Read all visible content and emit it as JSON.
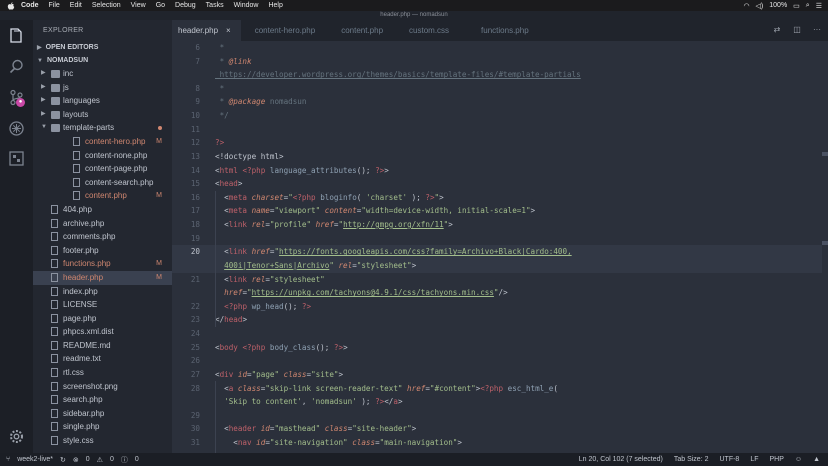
{
  "menubar": {
    "app": "Code",
    "items": [
      "File",
      "Edit",
      "Selection",
      "View",
      "Go",
      "Debug",
      "Tasks",
      "Window",
      "Help"
    ],
    "battery": "100%",
    "window_title": "header.php — nomadsun"
  },
  "sidebar": {
    "title": "EXPLORER",
    "open_editors": "OPEN EDITORS",
    "project": "NOMADSUN",
    "tree": [
      {
        "label": "inc",
        "type": "folder",
        "depth": 1
      },
      {
        "label": "js",
        "type": "folder",
        "depth": 1
      },
      {
        "label": "languages",
        "type": "folder",
        "depth": 1
      },
      {
        "label": "layouts",
        "type": "folder",
        "depth": 1
      },
      {
        "label": "template-parts",
        "type": "folder-open",
        "depth": 1,
        "mark": "dot"
      },
      {
        "label": "content-hero.php",
        "type": "file",
        "depth": 2,
        "mark": "M"
      },
      {
        "label": "content-none.php",
        "type": "file",
        "depth": 2,
        "mark": ""
      },
      {
        "label": "content-page.php",
        "type": "file",
        "depth": 2,
        "mark": ""
      },
      {
        "label": "content-search.php",
        "type": "file",
        "depth": 2,
        "mark": ""
      },
      {
        "label": "content.php",
        "type": "file",
        "depth": 2,
        "mark": "M"
      },
      {
        "label": "404.php",
        "type": "file",
        "depth": 1,
        "mark": ""
      },
      {
        "label": "archive.php",
        "type": "file",
        "depth": 1,
        "mark": ""
      },
      {
        "label": "comments.php",
        "type": "file",
        "depth": 1,
        "mark": ""
      },
      {
        "label": "footer.php",
        "type": "file",
        "depth": 1,
        "mark": ""
      },
      {
        "label": "functions.php",
        "type": "file",
        "depth": 1,
        "mark": "M"
      },
      {
        "label": "header.php",
        "type": "file",
        "depth": 1,
        "mark": "M",
        "active": true
      },
      {
        "label": "index.php",
        "type": "file",
        "depth": 1,
        "mark": ""
      },
      {
        "label": "LICENSE",
        "type": "file",
        "depth": 1,
        "mark": ""
      },
      {
        "label": "page.php",
        "type": "file",
        "depth": 1,
        "mark": ""
      },
      {
        "label": "phpcs.xml.dist",
        "type": "file",
        "depth": 1,
        "mark": ""
      },
      {
        "label": "README.md",
        "type": "file",
        "depth": 1,
        "mark": ""
      },
      {
        "label": "readme.txt",
        "type": "file",
        "depth": 1,
        "mark": ""
      },
      {
        "label": "rtl.css",
        "type": "file",
        "depth": 1,
        "mark": ""
      },
      {
        "label": "screenshot.png",
        "type": "file",
        "depth": 1,
        "mark": ""
      },
      {
        "label": "search.php",
        "type": "file",
        "depth": 1,
        "mark": ""
      },
      {
        "label": "sidebar.php",
        "type": "file",
        "depth": 1,
        "mark": ""
      },
      {
        "label": "single.php",
        "type": "file",
        "depth": 1,
        "mark": ""
      },
      {
        "label": "style.css",
        "type": "file",
        "depth": 1,
        "mark": ""
      }
    ]
  },
  "tabs": [
    {
      "label": "header.php",
      "active": true,
      "close": "×"
    },
    {
      "label": "content-hero.php",
      "active": false
    },
    {
      "label": "content.php",
      "active": false
    },
    {
      "label": "custom.css",
      "active": false
    },
    {
      "label": "functions.php",
      "active": false
    }
  ],
  "editor": {
    "current_line": "20",
    "lines": [
      {
        "n": "6",
        "html": "<span class='c-comment'> *</span>"
      },
      {
        "n": "7",
        "html": "<span class='c-comment'> * <span class='c-attr'>@link</span></span>"
      },
      {
        "n": "",
        "html": "<span class='c-url'> https://developer.wordpress.org/themes/basics/template-files/#template-partials</span>"
      },
      {
        "n": "8",
        "html": "<span class='c-comment'> *</span>"
      },
      {
        "n": "9",
        "html": "<span class='c-comment'> * <span class='c-attr'>@package</span> nomadsun</span>"
      },
      {
        "n": "10",
        "html": "<span class='c-comment'> */</span>"
      },
      {
        "n": "11",
        "html": ""
      },
      {
        "n": "12",
        "html": "<span class='c-php'>?&gt;</span>"
      },
      {
        "n": "13",
        "html": "&lt;!doctype html&gt;"
      },
      {
        "n": "14",
        "html": "&lt;<span class='c-tag'>html</span> <span class='c-php'>&lt;?php</span> <span class='c-fn'>language_attributes</span>(); <span class='c-php'>?&gt;</span>&gt;"
      },
      {
        "n": "15",
        "html": "&lt;<span class='c-tag'>head</span>&gt;"
      },
      {
        "n": "16",
        "html": "  &lt;<span class='c-tag'>meta</span> <span class='c-attr'>charset</span>=<span class='c-str'>\"</span><span class='c-php'>&lt;?php</span> <span class='c-fn'>bloginfo</span>( <span class='c-str'>'charset'</span> ); <span class='c-php'>?&gt;</span><span class='c-str'>\"</span>&gt;"
      },
      {
        "n": "17",
        "html": "  &lt;<span class='c-tag'>meta</span> <span class='c-attr'>name</span>=<span class='c-str'>\"viewport\"</span> <span class='c-attr'>content</span>=<span class='c-str'>\"width=device-width, initial-scale=1\"</span>&gt;"
      },
      {
        "n": "18",
        "html": "  &lt;<span class='c-tag'>link</span> <span class='c-attr'>rel</span>=<span class='c-str'>\"profile\"</span> <span class='c-attr'>href</span>=<span class='c-str'>\"<span class='c-link'>http://gmpg.org/xfn/11</span>\"</span>&gt;"
      },
      {
        "n": "19",
        "html": ""
      },
      {
        "n": "20",
        "html": "  &lt;<span class='c-tag'>link</span> <span class='c-attr'>href</span>=<span class='c-str'>\"<span class='c-link'>https://fonts.googleapis.com/css?family=Archivo+Black|Cardo:400,</span></span>",
        "cur": true
      },
      {
        "n": "",
        "html": "  <span class='c-str'><span class='c-link'>400i|Tenor+Sans|Archivo</span>\"</span> <span class='c-attr'>rel</span>=<span class='c-str'>\"stylesheet\"</span>&gt;",
        "cur": true
      },
      {
        "n": "21",
        "html": "  &lt;<span class='c-tag'>link</span> <span class='c-attr'>rel</span>=<span class='c-str'>\"stylesheet\"</span>"
      },
      {
        "n": "",
        "html": "  <span class='c-attr'>href</span>=<span class='c-str'>\"<span class='c-link'>https://unpkg.com/tachyons@4.9.1/css/tachyons.min.css</span>\"</span>/&gt;"
      },
      {
        "n": "22",
        "html": "  <span class='c-php'>&lt;?php</span> <span class='c-fn'>wp_head</span>(); <span class='c-php'>?&gt;</span>"
      },
      {
        "n": "23",
        "html": "&lt;/<span class='c-tag'>head</span>&gt;"
      },
      {
        "n": "24",
        "html": ""
      },
      {
        "n": "25",
        "html": "&lt;<span class='c-tag'>body</span> <span class='c-php'>&lt;?php</span> <span class='c-fn'>body_class</span>(); <span class='c-php'>?&gt;</span>&gt;"
      },
      {
        "n": "26",
        "html": ""
      },
      {
        "n": "27",
        "html": "&lt;<span class='c-tag'>div</span> <span class='c-attr'>id</span>=<span class='c-str'>\"page\"</span> <span class='c-attr'>class</span>=<span class='c-str'>\"site\"</span>&gt;"
      },
      {
        "n": "28",
        "html": "  &lt;<span class='c-tag'>a</span> <span class='c-attr'>class</span>=<span class='c-str'>\"skip-link screen-reader-text\"</span> <span class='c-attr'>href</span>=<span class='c-str'>\"#content\"</span>&gt;<span class='c-php'>&lt;?php</span> <span class='c-fn'>esc_html_e</span>("
      },
      {
        "n": "",
        "html": "  <span class='c-str'>'Skip to content'</span>, <span class='c-str'>'nomadsun'</span> ); <span class='c-php'>?&gt;</span>&lt;/<span class='c-tag'>a</span>&gt;"
      },
      {
        "n": "29",
        "html": ""
      },
      {
        "n": "30",
        "html": "  &lt;<span class='c-tag'>header</span> <span class='c-attr'>id</span>=<span class='c-str'>\"masthead\"</span> <span class='c-attr'>class</span>=<span class='c-str'>\"site-header\"</span>&gt;"
      },
      {
        "n": "31",
        "html": "    &lt;<span class='c-tag'>nav</span> <span class='c-attr'>id</span>=<span class='c-str'>\"site-navigation\"</span> <span class='c-attr'>class</span>=<span class='c-str'>\"main-navigation\"</span>&gt;"
      }
    ]
  },
  "statusbar": {
    "branch": "week2-live*",
    "errors": "0",
    "warnings": "0",
    "info": "0",
    "position": "Ln 20, Col 102 (7 selected)",
    "tab_size": "Tab Size: 2",
    "encoding": "UTF-8",
    "eol": "LF",
    "language": "PHP"
  }
}
